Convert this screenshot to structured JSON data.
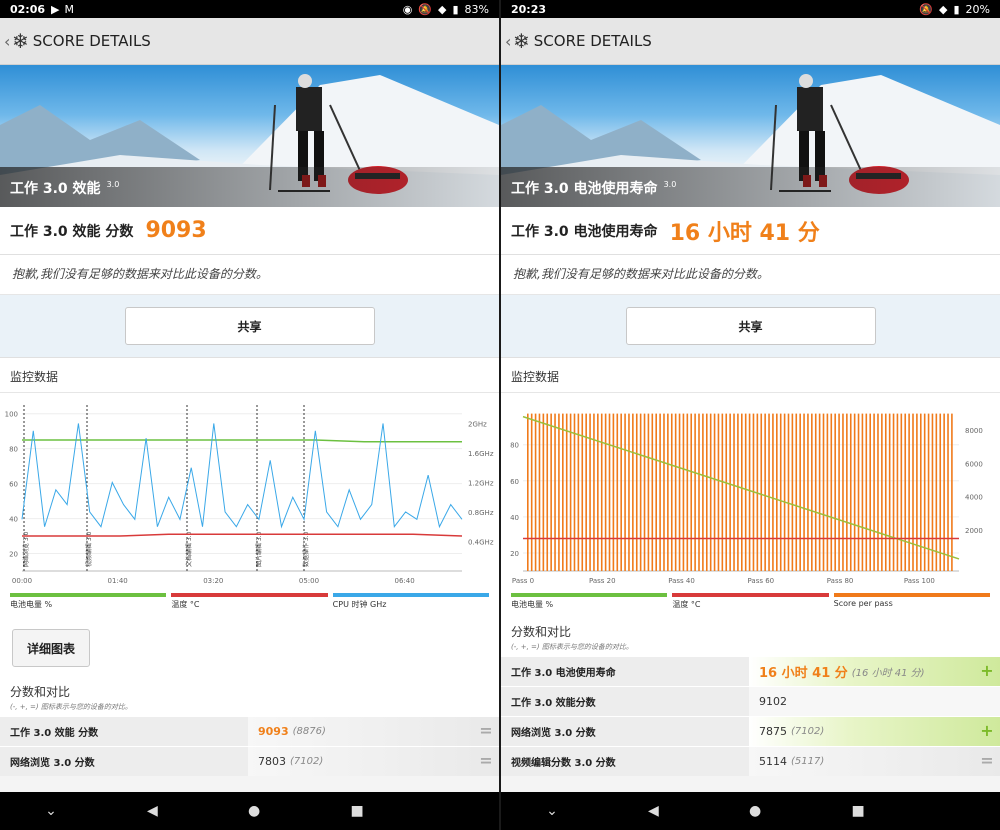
{
  "left": {
    "status": {
      "time": "02:06",
      "battery": "83%"
    },
    "appbar_title": "SCORE DETAILS",
    "hero_caption": "工作 3.0 效能",
    "hero_version": "3.0",
    "score_label": "工作 3.0 效能 分数",
    "score_value": "9093",
    "sorry_text": "抱歉,我们没有足够的数据来对比此设备的分数。",
    "share_label": "共享",
    "monitor_title": "监控数据",
    "detail_button": "详细图表",
    "compare_title": "分数和对比",
    "compare_sub": "(-, +, =) 图标表示与您的设备的对比。",
    "legend": [
      {
        "label": "电池电量 %",
        "color": "#6cc040"
      },
      {
        "label": "温度 °C",
        "color": "#d83a3a"
      },
      {
        "label": "CPU 时钟 GHz",
        "color": "#3aa8e8"
      }
    ],
    "rows": [
      {
        "name": "工作 3.0 效能 分数",
        "value": "9093",
        "avg": "(8876)",
        "state": "worse",
        "ctl": "="
      },
      {
        "name": "网络浏览 3.0 分数",
        "value": "7803",
        "avg": "(7102)",
        "state": "worse",
        "ctl": "="
      }
    ]
  },
  "right": {
    "status": {
      "time": "20:23",
      "battery": "20%"
    },
    "appbar_title": "SCORE DETAILS",
    "hero_caption": "工作 3.0 电池使用寿命",
    "hero_version": "3.0",
    "score_label": "工作 3.0 电池使用寿命",
    "score_value": "16 小时 41 分",
    "sorry_text": "抱歉,我们没有足够的数据来对比此设备的分数。",
    "share_label": "共享",
    "monitor_title": "监控数据",
    "compare_title": "分数和对比",
    "compare_sub": "(-, +, =) 图标表示与您的设备的对比。",
    "legend": [
      {
        "label": "电池电量 %",
        "color": "#6cc040"
      },
      {
        "label": "温度 °C",
        "color": "#d83a3a"
      },
      {
        "label": "Score per pass",
        "color": "#f07a1a"
      }
    ],
    "rows": [
      {
        "name": "工作 3.0 电池使用寿命",
        "value": "16 小时 41 分",
        "avg": "(16 小时 41 分)",
        "state": "better",
        "ctl": "+"
      },
      {
        "name": "工作 3.0 效能分数",
        "value": "9102",
        "avg": "",
        "state": "plain",
        "ctl": ""
      },
      {
        "name": "网络浏览 3.0 分数",
        "value": "7875",
        "avg": "(7102)",
        "state": "better",
        "ctl": "+"
      },
      {
        "name": "视频编辑分数 3.0 分数",
        "value": "5114",
        "avg": "(5117)",
        "state": "worse",
        "ctl": "="
      }
    ]
  },
  "chart_data": [
    {
      "type": "line",
      "x_ticks": [
        "00:00",
        "01:40",
        "03:20",
        "05:00",
        "06:40"
      ],
      "y_left_ticks": [
        "20",
        "40",
        "60",
        "80",
        "100"
      ],
      "y_right_ticks": [
        "0.4GHz",
        "0.8GHz",
        "1.2GHz",
        "1.6GHz",
        "2GHz"
      ],
      "ylim_left": [
        20,
        100
      ],
      "phase_labels": [
        "网络浏览 3.0",
        "视频编辑 3.0",
        "文档编辑 3.0",
        "图片编辑 3.0",
        "数据操作 3.0"
      ],
      "series": [
        {
          "name": "电池电量 %",
          "color": "#6cc040",
          "values": [
            85,
            85,
            85,
            85,
            85,
            85,
            85,
            84,
            84,
            84
          ]
        },
        {
          "name": "温度 °C",
          "color": "#d83a3a",
          "values": [
            30,
            30,
            30,
            31,
            31,
            31,
            31,
            31,
            31,
            30
          ]
        },
        {
          "name": "CPU 时钟 GHz",
          "color": "#3aa8e8",
          "values": [
            0.7,
            1.9,
            0.6,
            1.1,
            0.9,
            2.0,
            0.8,
            0.6,
            1.2,
            0.9,
            0.7,
            1.8,
            0.6,
            1.0,
            0.7,
            1.4,
            0.6,
            2.0,
            0.8,
            0.6,
            0.9,
            0.7,
            1.5,
            0.6,
            1.0,
            0.7,
            1.9,
            0.8,
            0.6,
            1.1,
            0.7,
            0.9,
            2.0,
            0.6,
            0.8,
            0.7,
            1.3,
            0.6,
            0.9,
            0.7
          ]
        }
      ]
    },
    {
      "type": "bar",
      "x_ticks": [
        "Pass 0",
        "Pass 20",
        "Pass 40",
        "Pass 60",
        "Pass 80",
        "Pass 100"
      ],
      "y_left_ticks": [
        "20",
        "40",
        "60",
        "80"
      ],
      "y_right_ticks": [
        "2000",
        "4000",
        "6000",
        "8000"
      ],
      "passes": 110,
      "series": [
        {
          "name": "电池电量 %",
          "color": "#9bbf3a",
          "start": 100,
          "end": 20
        },
        {
          "name": "温度 °C",
          "color": "#d83a3a",
          "value": 28
        },
        {
          "name": "Score per pass",
          "color": "#f07a1a",
          "value": 9000
        }
      ]
    }
  ]
}
